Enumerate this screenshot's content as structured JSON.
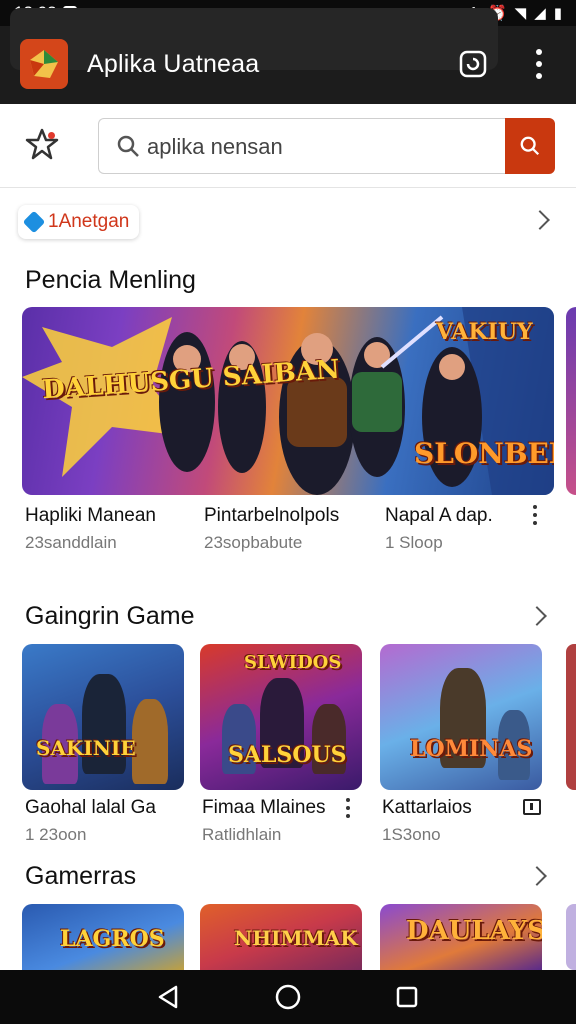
{
  "status_bar": {
    "time": "13:02"
  },
  "app_bar": {
    "title": "Aplika Uatneaa"
  },
  "search": {
    "value": "aplika nensan"
  },
  "chip": {
    "label": "1Anetgan"
  },
  "sections": [
    {
      "title": "Pencia Menling",
      "banner": {
        "logo_left": "DALHUSGU SAIBAN",
        "logo_right_top": "VAKIUY",
        "logo_right": "SLONBEN"
      },
      "cards": [
        {
          "title": "Hapliki Manean",
          "sub": "23sanddlain"
        },
        {
          "title": "Pintarbelnolpols",
          "sub": "23sopbabute"
        },
        {
          "title": "Napal A dap.",
          "sub": "1 Sloop"
        }
      ]
    },
    {
      "title": "Gaingrin Game",
      "cards": [
        {
          "title": "Gaohal lalal Ga",
          "sub": "1 23oon",
          "thumb_text": "SAKINIE"
        },
        {
          "title": "Fimaa Mlaines",
          "sub": "Ratlidhlain",
          "thumb_text_top": "SLWIDOS",
          "thumb_text": "SALSOUS"
        },
        {
          "title": "Kattarlaios",
          "sub": "1S3ono",
          "thumb_text": "LOMINAS"
        }
      ]
    },
    {
      "title": "Gamerras",
      "cards": [
        {
          "thumb_text": "LAGROS"
        },
        {
          "thumb_text": "NHIMMAK"
        },
        {
          "thumb_text": "DAULAYS"
        }
      ]
    }
  ],
  "colors": {
    "accent": "#c9380f",
    "brand": "#d4461a",
    "chip_text": "#d0361a"
  }
}
